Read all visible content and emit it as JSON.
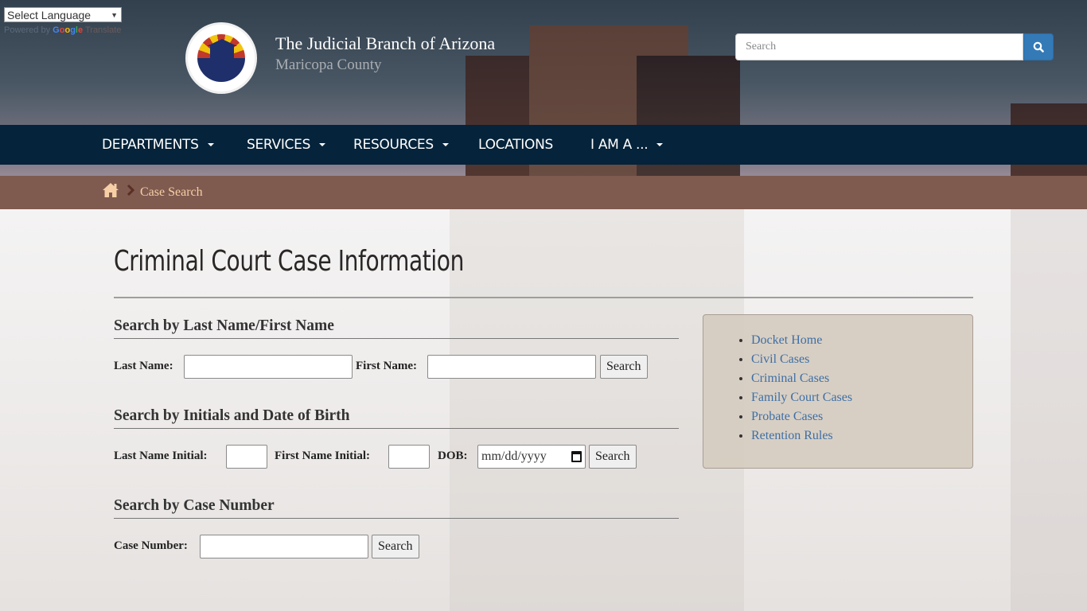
{
  "translate": {
    "select_label": "Select Language",
    "powered_by": "Powered by",
    "google": [
      "G",
      "o",
      "o",
      "g",
      "l",
      "e"
    ],
    "translate_word": "Translate"
  },
  "header": {
    "title": "The Judicial Branch of Arizona",
    "subtitle": "Maricopa County",
    "logo_alt": "The Judicial Branch of Arizona Maricopa County seal"
  },
  "search": {
    "placeholder": "Search",
    "value": "",
    "button_icon": "search-icon"
  },
  "nav": {
    "items": [
      {
        "label": "DEPARTMENTS",
        "has_dropdown": true
      },
      {
        "label": "SERVICES",
        "has_dropdown": true
      },
      {
        "label": "RESOURCES",
        "has_dropdown": true
      },
      {
        "label": "LOCATIONS",
        "has_dropdown": false
      },
      {
        "label": "I AM A ...",
        "has_dropdown": true
      }
    ]
  },
  "breadcrumb": {
    "home_icon": "home-icon",
    "separator_icon": "chevron-right-icon",
    "current": "Case Search"
  },
  "main": {
    "page_title": "Criminal Court Case Information",
    "sections": [
      {
        "heading": "Search by Last Name/First Name",
        "fields": [
          {
            "label": "Last Name:",
            "value": ""
          },
          {
            "label": "First Name:",
            "value": ""
          }
        ],
        "button": "Search"
      },
      {
        "heading": "Search by Initials and Date of Birth",
        "fields": [
          {
            "label": "Last Name Initial:",
            "value": ""
          },
          {
            "label": "First Name Initial:",
            "value": ""
          },
          {
            "label": "DOB:",
            "value": "",
            "placeholder": "mm/dd/yyyy"
          }
        ],
        "button": "Search"
      },
      {
        "heading": "Search by Case Number",
        "fields": [
          {
            "label": "Case Number:",
            "value": ""
          }
        ],
        "button": "Search"
      }
    ]
  },
  "sidebar": {
    "links": [
      {
        "label": "Docket Home"
      },
      {
        "label": "Civil Cases"
      },
      {
        "label": "Criminal Cases"
      },
      {
        "label": "Family Court Cases"
      },
      {
        "label": "Probate Cases"
      },
      {
        "label": "Retention Rules"
      }
    ]
  },
  "colors": {
    "nav_bg": "#05233a",
    "breadcrumb_bg": "#7f5a4f",
    "breadcrumb_text": "#f6cfa6",
    "search_button": "#337ab7",
    "link": "#3d6fa6",
    "sidebar_bg": "#d6ccc0"
  }
}
